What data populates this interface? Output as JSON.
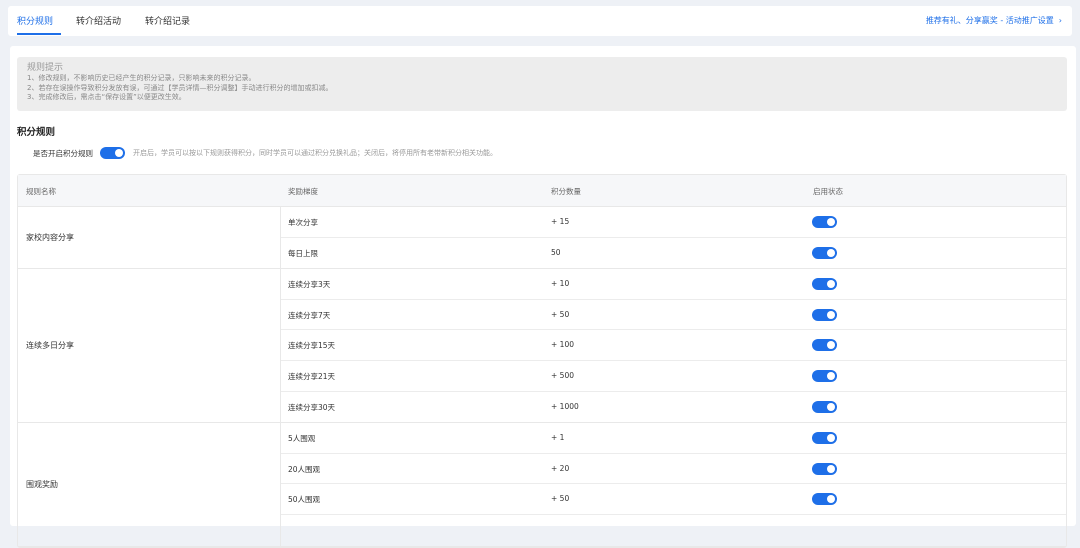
{
  "tabs": [
    {
      "label": "积分规则",
      "active": true
    },
    {
      "label": "转介绍活动",
      "active": false
    },
    {
      "label": "转介绍记录",
      "active": false
    }
  ],
  "top_link": "推荐有礼、分享赢奖 - 活动推广设置",
  "tips": {
    "title": "规则提示",
    "lines": [
      "1、修改规则，不影响历史已经产生的积分记录，只影响未来的积分记录。",
      "2、若存在误操作导致积分发放有误，可通过【学员详情—积分调整】手动进行积分的增加或扣减。",
      "3、完成修改后，需点击“保存设置”以便更改生效。"
    ]
  },
  "section_title": "积分规则",
  "master_switch": {
    "label": "是否开启积分规则",
    "on": true,
    "desc": "开启后，学员可以按以下规则获得积分，同时学员可以通过积分兑换礼品；关闭后，将停用所有老带新积分相关功能。"
  },
  "table": {
    "headers": [
      "规则名称",
      "奖励梯度",
      "积分数量",
      "启用状态"
    ],
    "groups": [
      {
        "name": "家校内容分享",
        "rows": [
          {
            "tier": "单次分享",
            "points": "+ 15",
            "enabled": true
          },
          {
            "tier": "每日上限",
            "points": "50",
            "enabled": true
          }
        ]
      },
      {
        "name": "连续多日分享",
        "rows": [
          {
            "tier": "连续分享3天",
            "points": "+ 10",
            "enabled": true
          },
          {
            "tier": "连续分享7天",
            "points": "+ 50",
            "enabled": true
          },
          {
            "tier": "连续分享15天",
            "points": "+ 100",
            "enabled": true
          },
          {
            "tier": "连续分享21天",
            "points": "+ 500",
            "enabled": true
          },
          {
            "tier": "连续分享30天",
            "points": "+ 1000",
            "enabled": true
          }
        ]
      },
      {
        "name": "围观奖励",
        "rows": [
          {
            "tier": "5人围观",
            "points": "+ 1",
            "enabled": true
          },
          {
            "tier": "20人围观",
            "points": "+ 20",
            "enabled": true
          },
          {
            "tier": "50人围观",
            "points": "+ 50",
            "enabled": true
          },
          {
            "tier": "",
            "points": "",
            "enabled": null
          }
        ]
      }
    ]
  }
}
